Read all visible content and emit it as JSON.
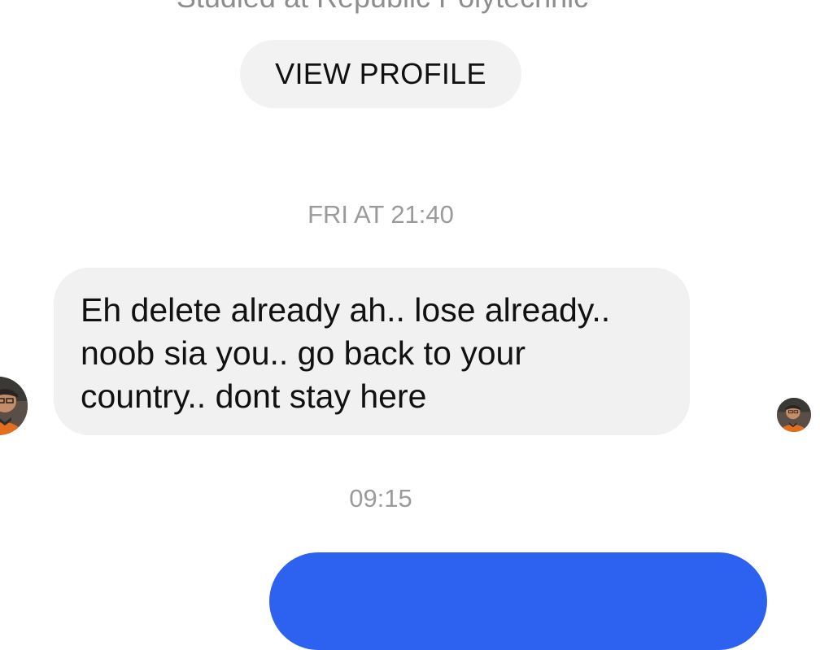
{
  "profile": {
    "subtitle": "Studied at Republic Polytechnic",
    "view_profile_label": "VIEW PROFILE"
  },
  "messages": [
    {
      "timestamp": "FRI AT 21:40",
      "direction": "incoming",
      "lines": [
        "Eh delete already ah.. lose already..",
        "noob sia you.. go back to your",
        "country.. dont stay here"
      ],
      "sender_avatar": "contact-avatar",
      "read_receipt_avatar": "seen-avatar"
    },
    {
      "timestamp": "09:15",
      "direction": "outgoing",
      "lines": []
    }
  ],
  "colors": {
    "incoming_bubble": "#f1f1f1",
    "outgoing_bubble": "#2d62f1",
    "timestamp_text": "#9b9b9b",
    "button_bg": "#f2f2f2"
  }
}
